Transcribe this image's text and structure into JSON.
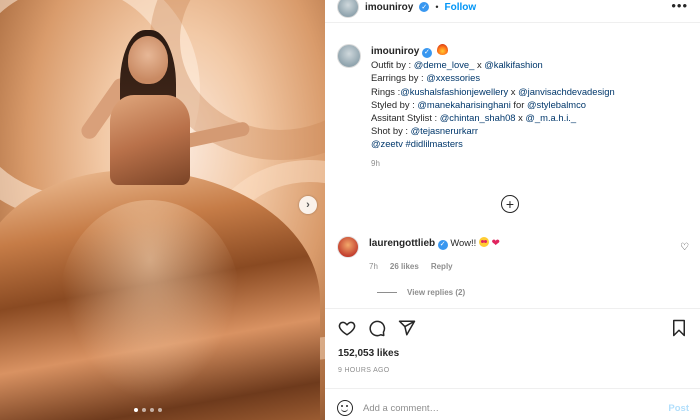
{
  "header": {
    "username": "imouniroy",
    "separator": "•",
    "follow_label": "Follow",
    "more_icon": "more-horizontal-icon"
  },
  "caption": {
    "username": "imouniroy",
    "lines": [
      {
        "prefix": "Outfit by : ",
        "links": [
          "@deme_love_",
          "@kalkifashion"
        ],
        "joiner": " x "
      },
      {
        "prefix": "Earrings by : ",
        "links": [
          "@xxessories"
        ],
        "joiner": ""
      },
      {
        "prefix": "Rings :",
        "links": [
          "@kushalsfashionjewellery",
          "@janvisachdevadesign"
        ],
        "joiner": " x "
      },
      {
        "prefix": "Styled by : ",
        "links": [
          "@manekaharisinghani",
          "@stylebalmco"
        ],
        "joiner": " for "
      },
      {
        "prefix": "Assitant Stylist : ",
        "links": [
          "@chintan_shah08",
          "@_m.a.h.i._"
        ],
        "joiner": " x "
      },
      {
        "prefix": "Shot by : ",
        "links": [
          "@tejasnerurkarr"
        ],
        "joiner": ""
      },
      {
        "prefix": "",
        "links": [
          "@zeetv",
          "#didlilmasters"
        ],
        "joiner": " "
      }
    ],
    "time": "9h"
  },
  "load_more_icon": "plus-circle-icon",
  "comment": {
    "username": "laurengottlieb",
    "text": "Wow!!",
    "time": "7h",
    "likes": "26 likes",
    "reply_label": "Reply",
    "view_replies": "View replies (2)"
  },
  "actions": {
    "like_icon": "heart-outline-icon",
    "comment_icon": "comment-icon",
    "share_icon": "send-icon",
    "save_icon": "bookmark-icon"
  },
  "likes": "152,053 likes",
  "posted": "9 HOURS AGO",
  "add_comment": {
    "placeholder": "Add a comment…",
    "post_label": "Post"
  },
  "carousel": {
    "next_icon": "chevron-right-icon",
    "slide_count": 4,
    "active_slide": 1
  },
  "colors": {
    "accent": "#0095f6",
    "verified": "#3897f0",
    "muted": "#8e8e8e",
    "link": "#00376b"
  }
}
